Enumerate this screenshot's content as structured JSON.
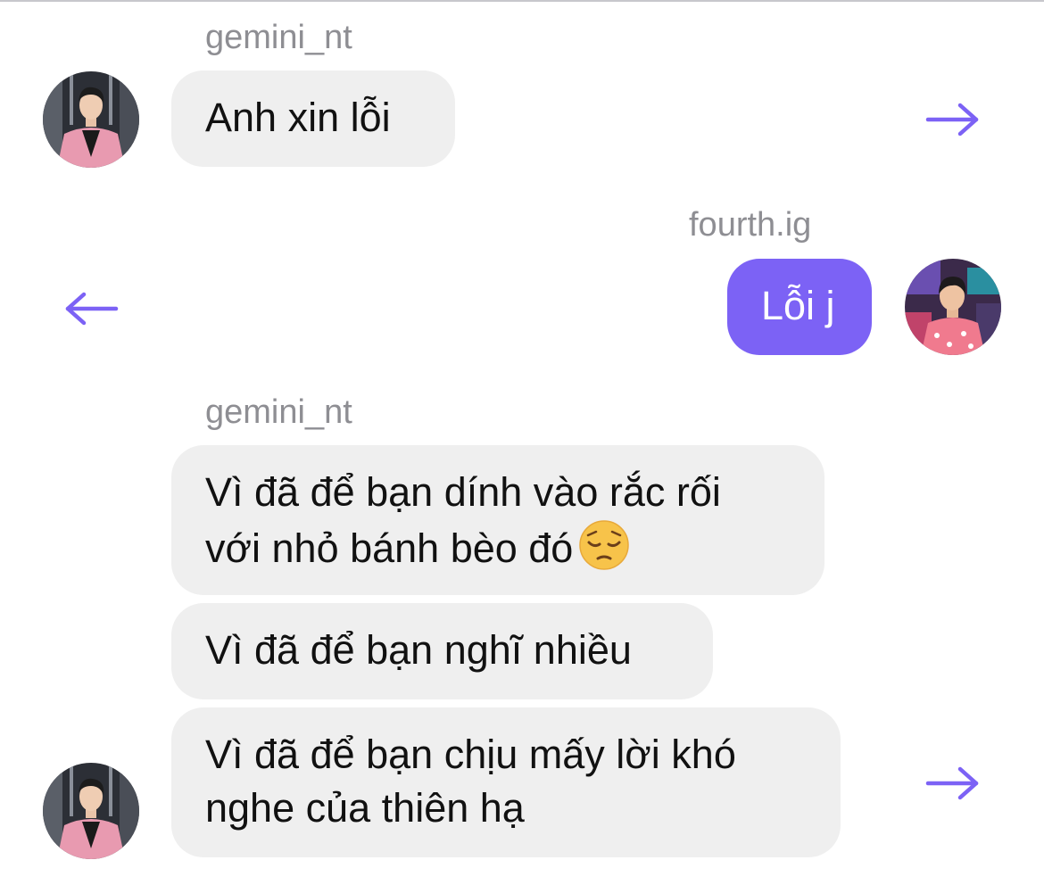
{
  "colors": {
    "accent": "#7c62f5",
    "incoming_bubble": "#efefef",
    "sender_text": "#8e8e93"
  },
  "messages": [
    {
      "sender": "gemini_nt",
      "text": "Anh xin lỗi",
      "direction": "incoming",
      "action_icon": "forward-arrow-icon"
    },
    {
      "sender": "fourth.ig",
      "text": "Lỗi j",
      "direction": "outgoing",
      "action_icon": "back-arrow-icon"
    },
    {
      "sender": "gemini_nt",
      "group": [
        {
          "line1": "Vì đã để bạn dính vào rắc rối",
          "line2": "với nhỏ bánh bèo đó",
          "emoji": "pensive-face-icon"
        },
        {
          "line1": "Vì đã để bạn nghĩ nhiều"
        },
        {
          "line1": "Vì đã để bạn chịu mấy lời khó",
          "line2": "nghe của thiên hạ"
        }
      ],
      "direction": "incoming",
      "action_icon": "forward-arrow-icon"
    }
  ]
}
